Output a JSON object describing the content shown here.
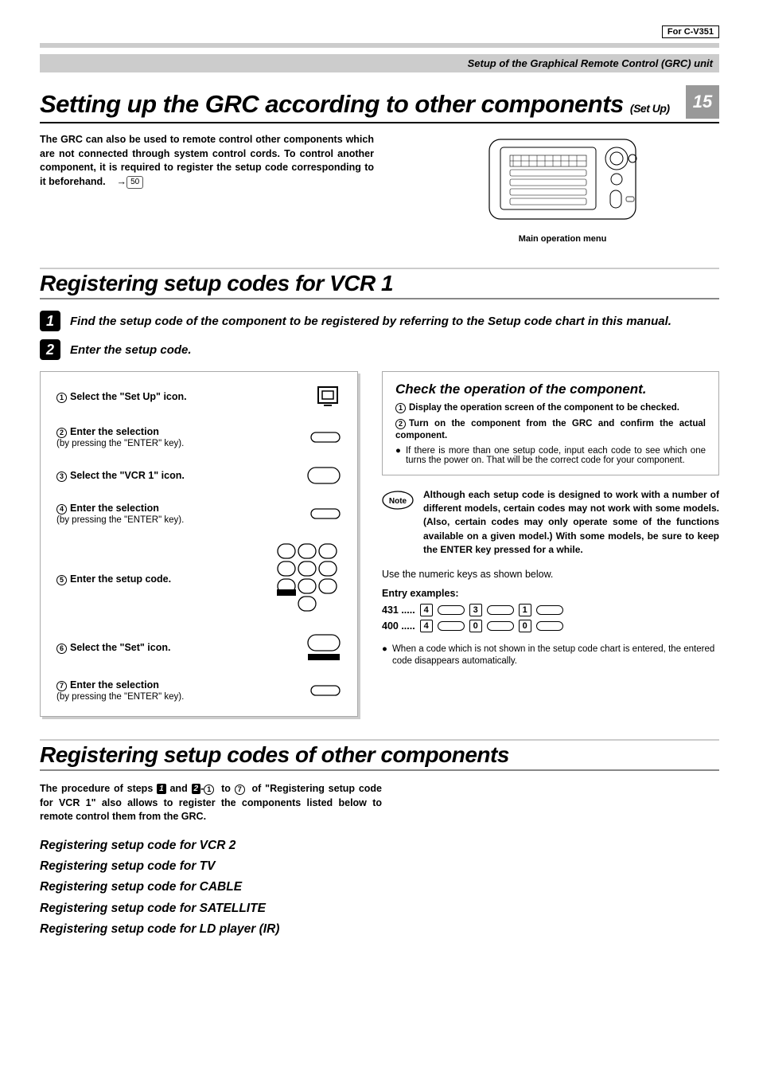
{
  "header": {
    "for_model": "For C-V351",
    "breadcrumb": "Setup of the Graphical Remote Control (GRC) unit",
    "page_number": "15"
  },
  "section1": {
    "title_main": "Setting up the GRC according to other components",
    "title_suffix": "(Set Up)",
    "intro": "The GRC can also be used to remote control other components which are not connected through system control cords. To control another component, it is required to register the setup code corresponding to it beforehand.",
    "ref_page": "50",
    "figure_caption": "Main operation menu"
  },
  "section2": {
    "title": "Registering setup codes for VCR 1",
    "step1": {
      "num": "1",
      "text": "Find the setup code of the component to be registered by referring to the Setup code chart in this manual."
    },
    "step2": {
      "num": "2",
      "text": "Enter the setup code."
    }
  },
  "panel": {
    "s1": {
      "n": "1",
      "label": "Select the \"Set Up\" icon."
    },
    "s2": {
      "n": "2",
      "label": "Enter the selection",
      "sub": "(by pressing the \"ENTER\" key)."
    },
    "s3": {
      "n": "3",
      "label": "Select the \"VCR 1\" icon."
    },
    "s4": {
      "n": "4",
      "label": "Enter the selection",
      "sub": "(by pressing the \"ENTER\" key)."
    },
    "s5": {
      "n": "5",
      "label": "Enter the setup code."
    },
    "s6": {
      "n": "6",
      "label": "Select the \"Set\" icon."
    },
    "s7": {
      "n": "7",
      "label": "Enter the selection",
      "sub": "(by pressing the \"ENTER\" key)."
    }
  },
  "check": {
    "title": "Check the operation of the component.",
    "l1n": "1",
    "l1": "Display the operation screen of the component to be checked.",
    "l2n": "2",
    "l2": "Turn on the component from the GRC and confirm the actual component.",
    "bullet": "If there is more than one setup code, input each code to see which one turns the power on. That will be the correct code for your component."
  },
  "note": {
    "text": "Although each setup code is designed to work with a number of different models, certain codes may not work with some models. (Also, certain codes may only operate some of the functions available on a given model.) With some models, be sure to keep the ENTER key pressed for a while."
  },
  "entry": {
    "lead": "Use the numeric keys as shown below.",
    "heading": "Entry examples:",
    "ex1_code": "431",
    "ex1_d1": "4",
    "ex1_d2": "3",
    "ex1_d3": "1",
    "ex2_code": "400",
    "ex2_d1": "4",
    "ex2_d2": "0",
    "ex2_d3": "0",
    "auto": "When a code which is not shown in the setup code chart is entered, the entered code disappears automatically."
  },
  "section3": {
    "title": "Registering setup codes of other components",
    "intro_a": "The procedure of steps ",
    "badge1": "1",
    "intro_b": " and ",
    "badge2": "2",
    "intro_c": "-",
    "c1": "1",
    "intro_d": " to ",
    "c7": "7",
    "intro_e": " of \"Registering setup code for VCR 1\" also allows to register the components listed below to remote control them from the GRC.",
    "items": {
      "i1": "Registering setup code for VCR 2",
      "i2": "Registering setup code for TV",
      "i3": "Registering setup code for CABLE",
      "i4": "Registering setup code for SATELLITE",
      "i5": "Registering setup code for LD player (IR)"
    }
  }
}
